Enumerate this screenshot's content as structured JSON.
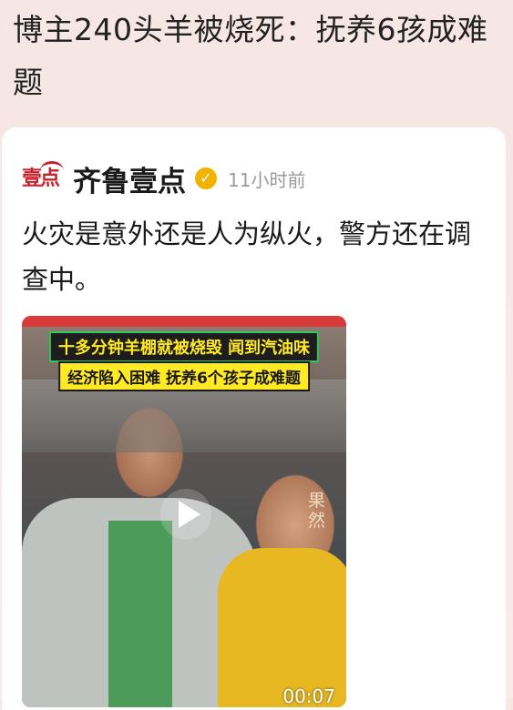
{
  "headline": "博主240头羊被烧死：抚养6孩成难题",
  "post": {
    "source_logo_text": "壹点",
    "source_name": "齐鲁壹点",
    "verified_icon": "verified-badge-icon",
    "time": "11小时前",
    "text": "火灾是意外还是人为纵火，警方还在调查中。"
  },
  "video": {
    "banner1": "十多分钟羊棚就被烧毁 闻到汽油味",
    "banner2": "经济陷入困难 抚养6个孩子成难题",
    "watermark": "果然",
    "duration": "00:07"
  },
  "colors": {
    "brand_red": "#c8202a",
    "verified": "#f1b300",
    "banner_yellow": "#ffe923"
  }
}
